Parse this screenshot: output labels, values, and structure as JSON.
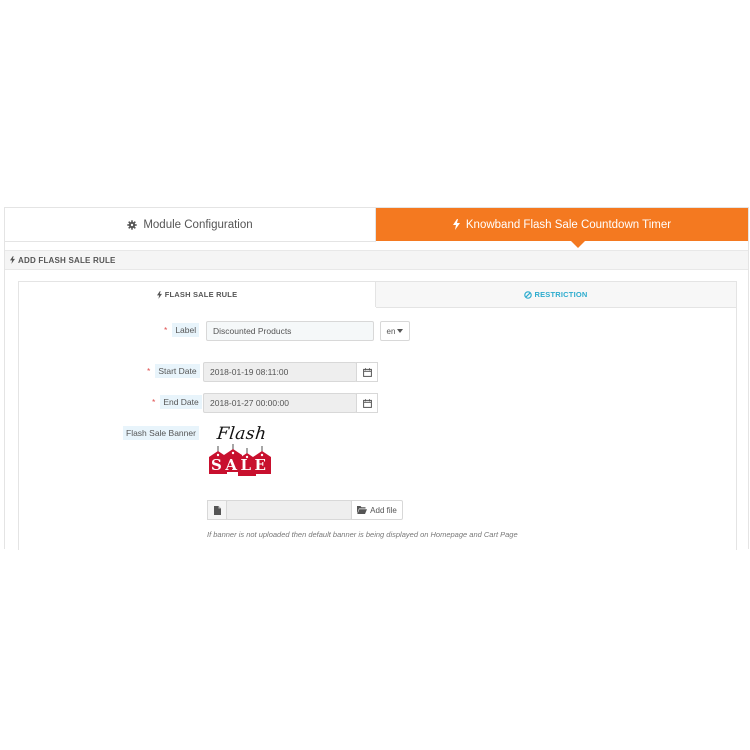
{
  "tabs": {
    "module_config": "Module Configuration",
    "flash_timer": "Knowband Flash Sale Countdown Timer"
  },
  "section": {
    "title": "ADD FLASH SALE RULE"
  },
  "inner_tabs": {
    "rule": "FLASH SALE RULE",
    "restriction": "RESTRICTION"
  },
  "form": {
    "label": {
      "label": "Label",
      "value": "Discounted Products",
      "lang": "en"
    },
    "start_date": {
      "label": "Start Date",
      "value": "2018-01-19 08:11:00"
    },
    "end_date": {
      "label": "End Date",
      "value": "2018-01-27 00:00:00"
    },
    "banner": {
      "label": "Flash Sale Banner",
      "logo_line1": "Flash",
      "logo_line2": "SALE",
      "add_file": "Add file",
      "help": "If banner is not uploaded then default banner is being displayed on Homepage and Cart Page"
    }
  },
  "colors": {
    "accent": "#f47920",
    "link": "#2eacce",
    "required": "#e05050"
  }
}
